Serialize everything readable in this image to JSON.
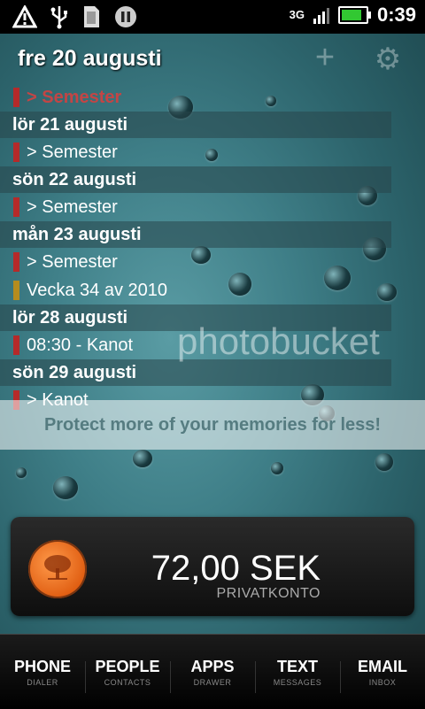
{
  "status_bar": {
    "time": "0:39",
    "network": "3G",
    "icons": [
      "warning-icon",
      "usb-icon",
      "sd-card-icon",
      "pause-icon"
    ]
  },
  "agenda": {
    "today": "fre 20 augusti",
    "current_event": "> Semester",
    "days": [
      {
        "date": "lör 21 augusti",
        "events": [
          {
            "text": "> Semester",
            "color": "#b52a2a"
          }
        ]
      },
      {
        "date": "sön 22 augusti",
        "events": [
          {
            "text": "> Semester",
            "color": "#b52a2a"
          }
        ]
      },
      {
        "date": "mån 23 augusti",
        "events": [
          {
            "text": "> Semester",
            "color": "#b52a2a"
          },
          {
            "text": "Vecka 34 av 2010",
            "color": "#b58c1e"
          }
        ]
      },
      {
        "date": "lör 28 augusti",
        "events": [
          {
            "text": "08:30 - Kanot",
            "color": "#b52a2a"
          }
        ]
      },
      {
        "date": "sön 29 augusti",
        "events": [
          {
            "text": "> Kanot",
            "color": "#b52a2a"
          }
        ]
      }
    ]
  },
  "watermark": {
    "text": "photobucket",
    "banner": "Protect more of your memories for less!"
  },
  "bank": {
    "balance": "72,00 SEK",
    "account": "PRIVATKONTO"
  },
  "dock": [
    {
      "label": "PHONE",
      "sub": "DIALER"
    },
    {
      "label": "PEOPLE",
      "sub": "CONTACTS"
    },
    {
      "label": "APPS",
      "sub": "DRAWER"
    },
    {
      "label": "TEXT",
      "sub": "MESSAGES"
    },
    {
      "label": "EMAIL",
      "sub": "INBOX"
    }
  ]
}
